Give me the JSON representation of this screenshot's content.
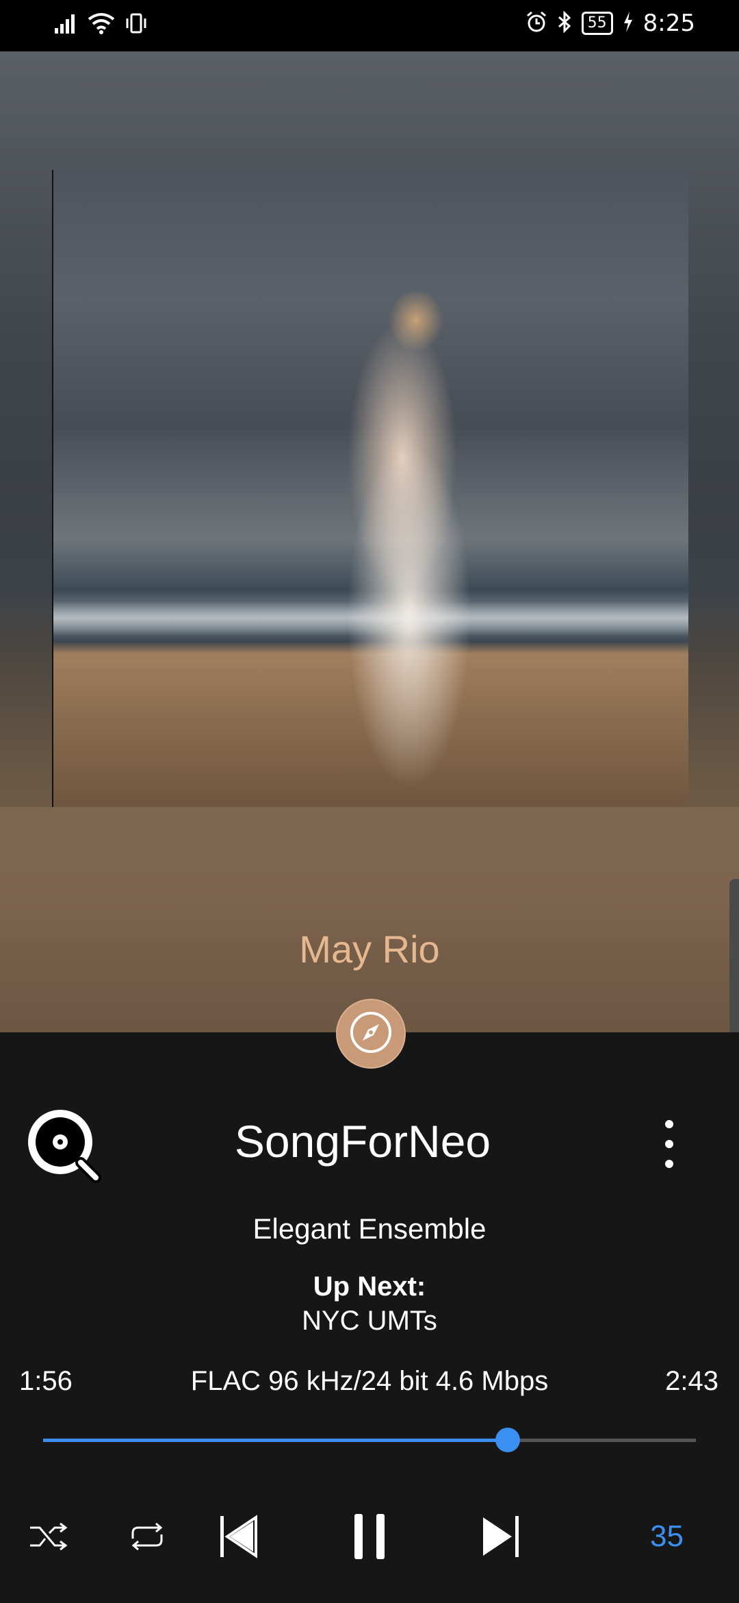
{
  "status_bar": {
    "time": "8:25",
    "battery": "55",
    "icons": [
      "signal-icon",
      "wifi-icon",
      "vibrate-icon",
      "alarm-icon",
      "bluetooth-icon",
      "battery-icon",
      "charging-icon"
    ]
  },
  "now_playing": {
    "artist": "May Rio",
    "title": "SongForNeo",
    "album": "Elegant Ensemble",
    "up_next_label": "Up Next:",
    "up_next_track": "NYC UMTs",
    "elapsed": "1:56",
    "format": "FLAC 96 kHz/24 bit 4.6 Mbps",
    "duration": "2:43",
    "progress_fraction": 0.712
  },
  "controls": {
    "queue_count": "35",
    "icons": [
      "shuffle-icon",
      "repeat-icon",
      "previous-icon",
      "pause-icon",
      "next-icon"
    ]
  },
  "colors": {
    "accent": "#3a8ff0",
    "artist_text": "#e5b890",
    "compass_button": "#c89a78",
    "background": "#161616"
  }
}
